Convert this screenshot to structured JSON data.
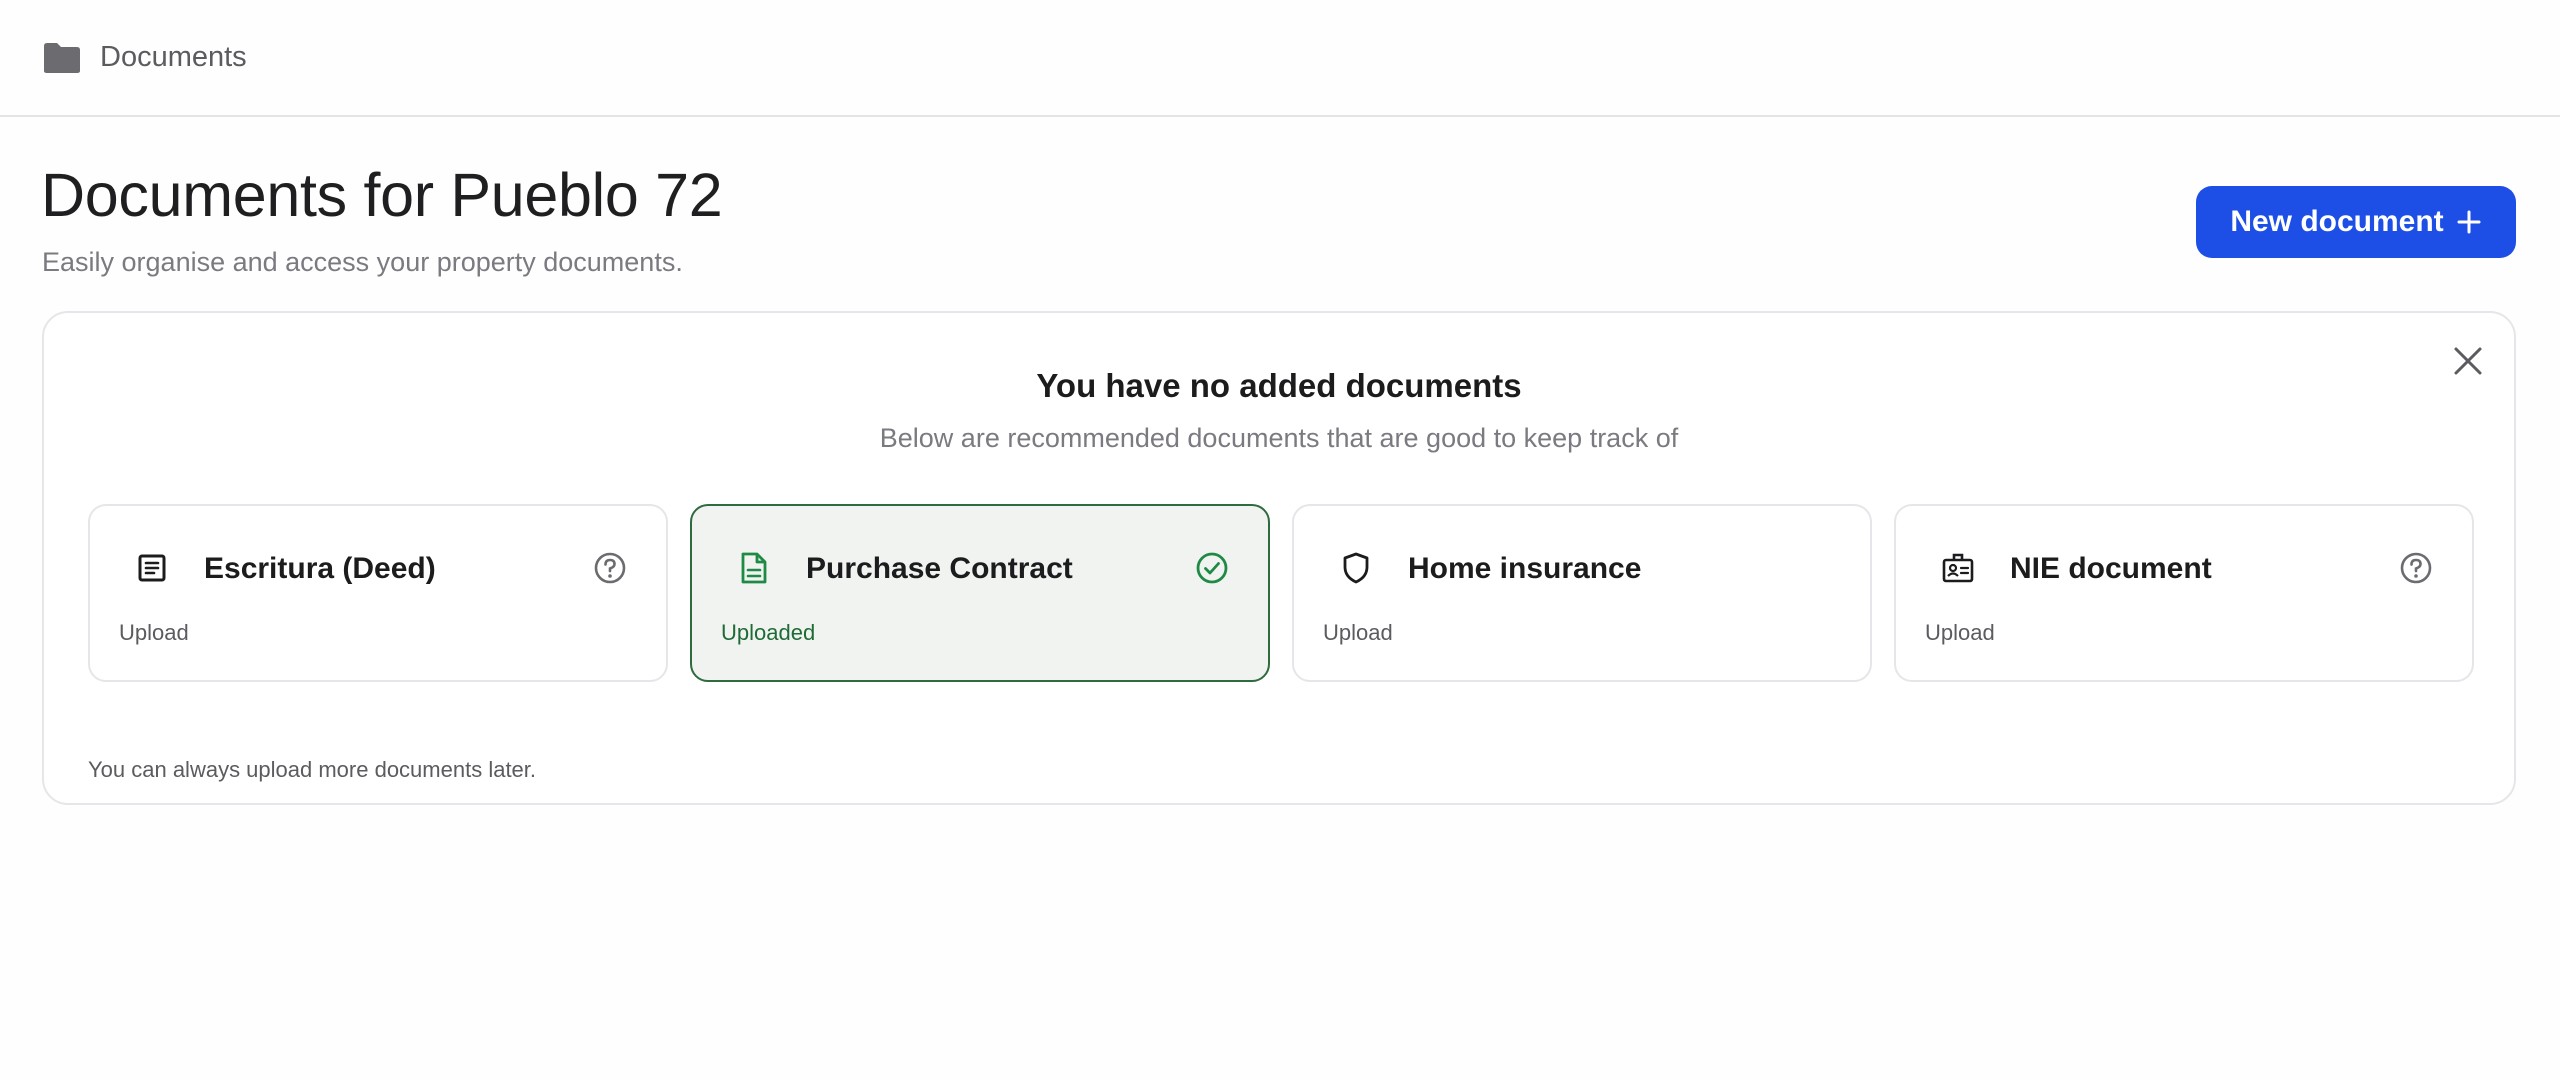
{
  "breadcrumb": {
    "label": "Documents",
    "icon": "folder-icon"
  },
  "header": {
    "title": "Documents for Pueblo 72",
    "subtitle": "Easily organise and access your property documents.",
    "new_button_label": "New document"
  },
  "empty_state": {
    "title": "You have no added documents",
    "subtitle": "Below are recommended documents that are good to keep track of",
    "footer": "You can always upload more documents later."
  },
  "recommended": [
    {
      "title": "Escritura (Deed)",
      "action": "Upload",
      "icon": "document-lines-icon",
      "status_icon": "help-circle-icon",
      "uploaded": false
    },
    {
      "title": "Purchase Contract",
      "action": "Uploaded",
      "icon": "file-text-icon",
      "status_icon": "check-circle-icon",
      "uploaded": true
    },
    {
      "title": "Home insurance",
      "action": "Upload",
      "icon": "shield-icon",
      "status_icon": null,
      "uploaded": false
    },
    {
      "title": "NIE document",
      "action": "Upload",
      "icon": "id-badge-icon",
      "status_icon": "help-circle-icon",
      "uploaded": false
    }
  ],
  "colors": {
    "primary": "#1d4ee5",
    "success": "#1f8a45",
    "success_border": "#2e6b3f",
    "muted_text": "#7a7a80"
  }
}
